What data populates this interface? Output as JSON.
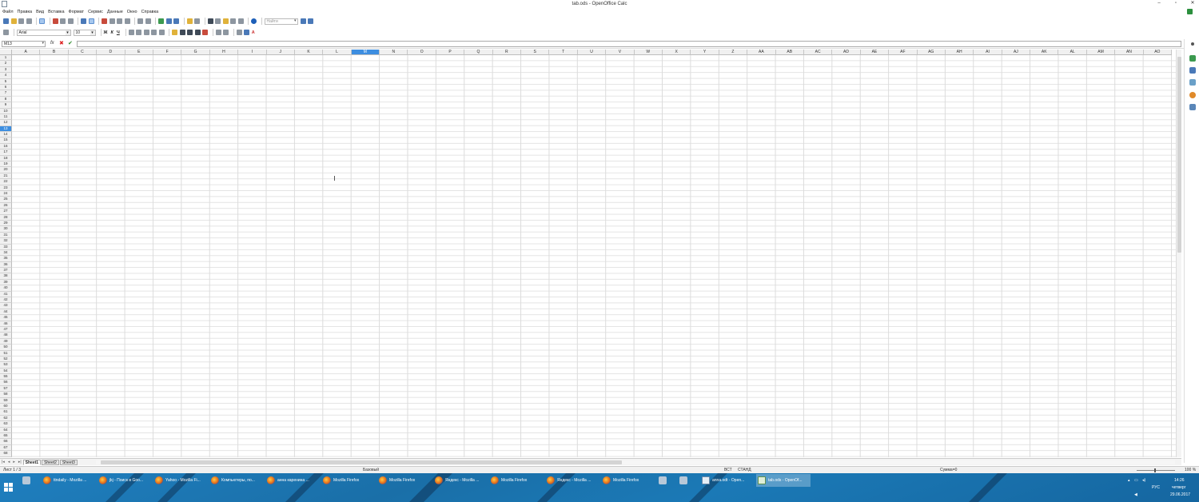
{
  "window": {
    "title": "tab.ods - OpenOffice Calc",
    "controls": [
      "–",
      "▫",
      "✕"
    ]
  },
  "menu": [
    "Файл",
    "Правка",
    "Вид",
    "Вставка",
    "Формат",
    "Сервис",
    "Данные",
    "Окно",
    "Справка"
  ],
  "toolbar": {
    "find_placeholder": "Найти"
  },
  "format_toolbar": {
    "font_name": "Arial",
    "font_size": "10",
    "bold": "Ж",
    "italic": "К",
    "underline": "Ч",
    "font_color": "A"
  },
  "formula_bar": {
    "name_box": "M13",
    "fx_label": "fx",
    "cancel_symbol": "✖",
    "accept_symbol": "✔",
    "content": ""
  },
  "grid": {
    "columns": [
      "A",
      "B",
      "C",
      "D",
      "E",
      "F",
      "G",
      "H",
      "I",
      "J",
      "K",
      "L",
      "M",
      "N",
      "O",
      "P",
      "Q",
      "R",
      "S",
      "T",
      "U",
      "V",
      "W",
      "X",
      "Y",
      "Z",
      "AA",
      "AB",
      "AC",
      "AD",
      "AE",
      "AF",
      "AG",
      "AH",
      "AI",
      "AJ",
      "AK",
      "AL",
      "AM",
      "AN",
      "AO"
    ],
    "active_column": "M",
    "active_row": 13,
    "row_count": 68
  },
  "sheets": [
    "Sheet1",
    "Sheet2",
    "Sheet3"
  ],
  "active_sheet": "Sheet1",
  "status": {
    "sheet_info": "Лист 1 / 3",
    "style": "Базовый",
    "insert_mode": "ВСТ",
    "selection_mode": "СТАНД",
    "sum": "Сумма=0",
    "zoom": "100 %"
  },
  "taskbar": {
    "items": [
      {
        "label": "ttndaily - Mozilla ...",
        "icon": "firefox-icon",
        "active": false
      },
      {
        "label": "jkj - Поиск в Goo...",
        "icon": "firefox-icon",
        "active": false
      },
      {
        "label": "Yahoo - Mozilla Fi...",
        "icon": "firefox-icon",
        "active": false
      },
      {
        "label": "Компьютеры, по...",
        "icon": "firefox-icon",
        "active": false
      },
      {
        "label": "анна каренина ...",
        "icon": "firefox-icon",
        "active": false
      },
      {
        "label": "Mozilla Firefox",
        "icon": "firefox-icon",
        "active": false
      },
      {
        "label": "Mozilla Firefox",
        "icon": "firefox-icon",
        "active": false
      },
      {
        "label": "Яндекс - Mozilla ...",
        "icon": "firefox-icon",
        "active": false
      },
      {
        "label": "Mozilla Firefox",
        "icon": "firefox-icon",
        "active": false
      },
      {
        "label": "Яндекс - Mozilla ...",
        "icon": "firefox-icon",
        "active": false
      },
      {
        "label": "Mozilla Firefox",
        "icon": "firefox-icon",
        "active": false
      },
      {
        "label": "",
        "icon": "system-icon",
        "active": false
      },
      {
        "label": "",
        "icon": "system-icon",
        "active": false
      },
      {
        "label": "anna.odt - Open...",
        "icon": "writer-icon",
        "active": false
      },
      {
        "label": "tab.ods - OpenOf...",
        "icon": "calc-icon",
        "active": true
      }
    ],
    "tray": {
      "language": "РУС",
      "time": "14:26",
      "day": "четверг",
      "date": "29.06.2017"
    }
  },
  "colors": {
    "accent": "#3d8ee0",
    "taskbar": "#1b79b6"
  }
}
